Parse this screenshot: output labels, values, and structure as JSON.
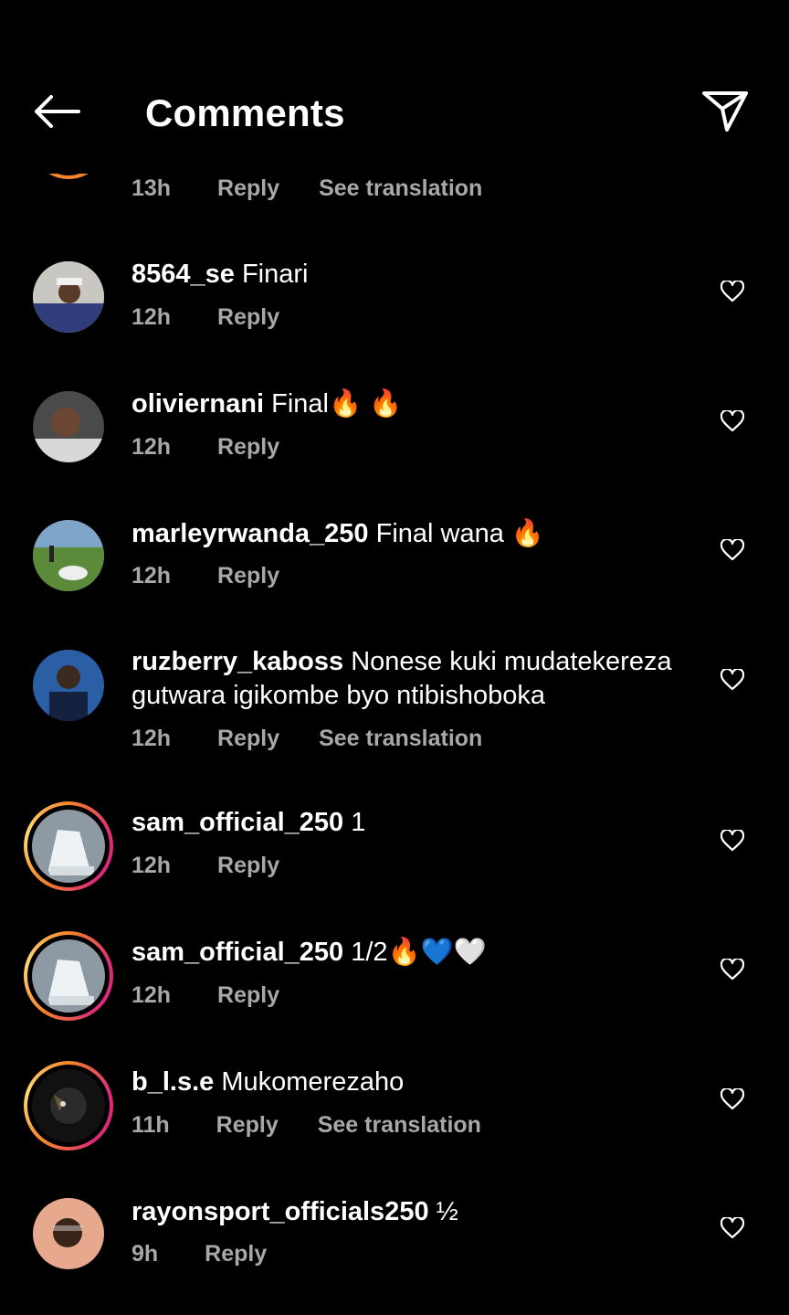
{
  "header": {
    "title": "Comments",
    "back_icon": "arrow-left-icon",
    "share_icon": "paper-plane-icon"
  },
  "partial_comment": {
    "time": "13h",
    "reply": "Reply",
    "see_translation": "See translation"
  },
  "comments": [
    {
      "username": "8564_se",
      "text": "Finari",
      "time": "12h",
      "reply": "Reply"
    },
    {
      "username": "oliviernani",
      "text": "Final🔥 🔥",
      "time": "12h",
      "reply": "Reply"
    },
    {
      "username": "marleyrwanda_250",
      "text": "Final wana 🔥",
      "time": "12h",
      "reply": "Reply"
    },
    {
      "username": "ruzberry_kaboss",
      "text": "Nonese kuki mudatekereza gutwara igikombe byo ntibishoboka",
      "time": "12h",
      "reply": "Reply",
      "see_translation": "See translation"
    },
    {
      "username": "sam_official_250",
      "text": "1",
      "time": "12h",
      "reply": "Reply"
    },
    {
      "username": "sam_official_250",
      "text": "1/2🔥💙🤍",
      "time": "12h",
      "reply": "Reply"
    },
    {
      "username": "b_l.s.e",
      "text": "Mukomerezaho",
      "time": "11h",
      "reply": "Reply",
      "see_translation": "See translation"
    },
    {
      "username": "rayonsport_officials250",
      "text": "½",
      "time": "9h",
      "reply": "Reply"
    }
  ],
  "colors": {
    "background": "#000000",
    "text": "#ffffff",
    "meta": "#a8a8a8",
    "story_ring_start": "#f58529",
    "story_ring_end": "#dd2a7b"
  }
}
